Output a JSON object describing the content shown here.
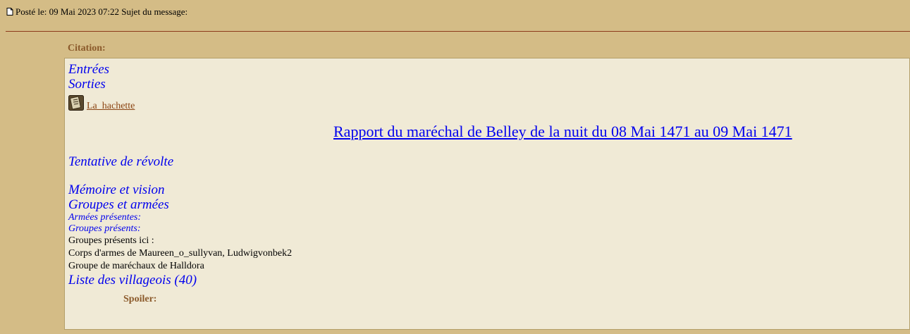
{
  "post": {
    "header_text": "Posté le: 09 Mai 2023 07:22 Sujet du message:"
  },
  "citation": {
    "label": "Citation:",
    "links": {
      "entrees": "Entrées",
      "sorties": "Sorties",
      "hachette": "La_hachette"
    },
    "rapport_title": "Rapport du maréchal de Belley de la nuit du 08 Mai 1471 au 09 Mai 1471",
    "revolte": "Tentative de révolte",
    "memoire": "Mémoire et vision",
    "groupes_armees": "Groupes et armées",
    "armees_presentes": "Armées présentes:",
    "groupes_presents": "Groupes présents:",
    "groupes_ici_label": "Groupes présents ici :",
    "groupes_ici": [
      "Corps d'armes de Maureen_o_sullyvan, Ludwigvonbek2",
      "Groupe de maréchaux de Halldora"
    ],
    "villageois": "Liste des villageois (40)",
    "spoiler_label": "Spoiler:"
  },
  "colors": {
    "page_background": "#d4bc86",
    "quote_background": "#f0ead6",
    "link_blue": "#0000ee",
    "label_brown": "#8b5a2b",
    "separator": "#8c3a1a"
  },
  "icons": {
    "post": "post-icon",
    "book": "book-icon"
  }
}
